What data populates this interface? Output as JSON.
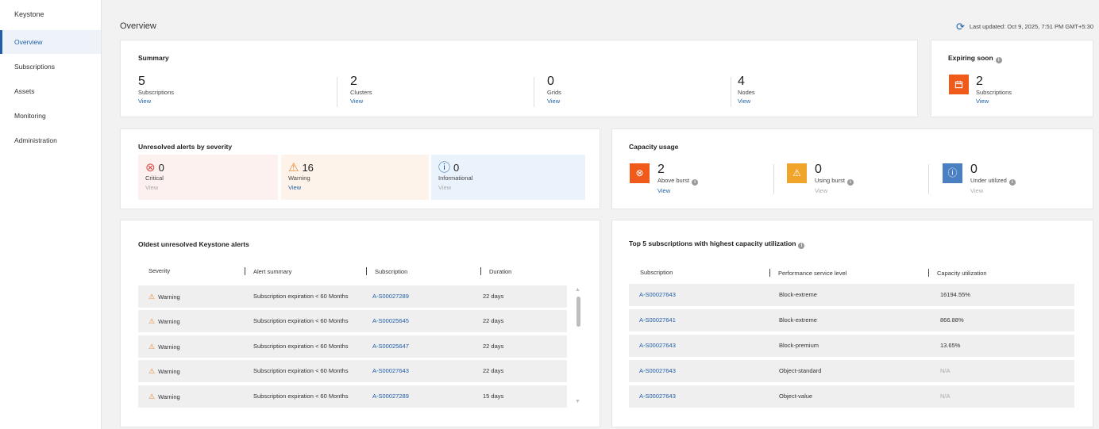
{
  "sidebar": {
    "brand": "Keystone",
    "items": [
      {
        "label": "Overview"
      },
      {
        "label": "Subscriptions"
      },
      {
        "label": "Assets"
      },
      {
        "label": "Monitoring"
      },
      {
        "label": "Administration"
      }
    ]
  },
  "header": {
    "title": "Overview",
    "last_updated": "Last updated: Oct 9, 2025, 7:51 PM GMT+5:30",
    "refresh_icon": "refresh-icon"
  },
  "summary": {
    "title": "Summary",
    "stats": [
      {
        "value": "5",
        "label": "Subscriptions",
        "link": "View"
      },
      {
        "value": "2",
        "label": "Clusters",
        "link": "View"
      },
      {
        "value": "0",
        "label": "Grids",
        "link": "View"
      },
      {
        "value": "4",
        "label": "Nodes",
        "link": "View"
      }
    ]
  },
  "expiring": {
    "title": "Expiring soon",
    "info": "i",
    "value": "2",
    "label": "Subscriptions",
    "link": "View",
    "icon": "calendar-icon",
    "color": "#f05a1a"
  },
  "alerts_by_severity": {
    "title": "Unresolved alerts by severity",
    "items": [
      {
        "icon": "⊗",
        "value": "0",
        "label": "Critical",
        "link": "View",
        "icon_color": "#d9534f",
        "bg": "#fcf1ef"
      },
      {
        "icon": "⚠",
        "value": "16",
        "label": "Warning",
        "link": "View",
        "icon_color": "#e8862a",
        "bg": "#fdf3ea"
      },
      {
        "icon": "ⓘ",
        "value": "0",
        "label": "Informational",
        "link": "View",
        "icon_color": "#1f5fa8",
        "bg": "#eaf3fb"
      }
    ]
  },
  "capacity": {
    "title": "Capacity usage",
    "info": "i",
    "items": [
      {
        "icon": "⊗",
        "value": "2",
        "label": "Above burst",
        "link": "View",
        "color": "#f05a1a"
      },
      {
        "icon": "⚠",
        "value": "0",
        "label": "Using burst",
        "link": "View",
        "color": "#f0a52a"
      },
      {
        "icon": "ⓘ",
        "value": "0",
        "label": "Under utilized",
        "link": "View",
        "color": "#4a7fc1"
      }
    ]
  },
  "oldest_alerts": {
    "title": "Oldest unresolved Keystone alerts",
    "columns": [
      "Severity",
      "Alert summary",
      "Subscription",
      "Duration"
    ],
    "rows": [
      {
        "severity": "Warning",
        "summary": "Subscription expiration < 60 Months",
        "subscription": "A-S00027289",
        "duration": "22 days"
      },
      {
        "severity": "Warning",
        "summary": "Subscription expiration < 60 Months",
        "subscription": "A-S00025645",
        "duration": "22 days"
      },
      {
        "severity": "Warning",
        "summary": "Subscription expiration < 60 Months",
        "subscription": "A-S00025647",
        "duration": "22 days"
      },
      {
        "severity": "Warning",
        "summary": "Subscription expiration < 60 Months",
        "subscription": "A-S00027643",
        "duration": "22 days"
      },
      {
        "severity": "Warning",
        "summary": "Subscription expiration < 60 Months",
        "subscription": "A-S00027289",
        "duration": "15 days"
      }
    ]
  },
  "top_subscriptions": {
    "title": "Top 5 subscriptions with highest capacity utilization",
    "info": "i",
    "columns": [
      "Subscription",
      "Performance service level",
      "Capacity utilization"
    ],
    "rows": [
      {
        "subscription": "A-S00027643",
        "level": "Block-extreme",
        "utilization": "16194.55%"
      },
      {
        "subscription": "A-S00027641",
        "level": "Block-extreme",
        "utilization": "866.88%"
      },
      {
        "subscription": "A-S00027643",
        "level": "Block-premium",
        "utilization": "13.65%"
      },
      {
        "subscription": "A-S00027643",
        "level": "Object-standard",
        "utilization": "N/A"
      },
      {
        "subscription": "A-S00027643",
        "level": "Object-value",
        "utilization": "N/A"
      }
    ]
  }
}
